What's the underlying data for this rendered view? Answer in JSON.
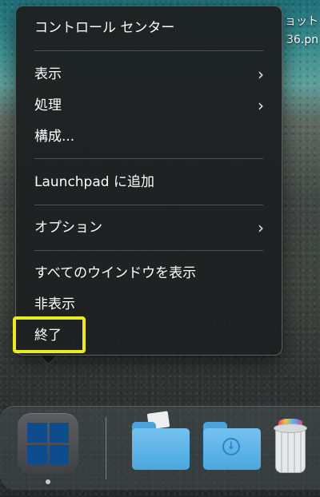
{
  "desktop": {
    "label_line1": "ョット",
    "label_line2": "36.pn"
  },
  "context_menu": {
    "items": [
      {
        "label": "コントロール センター",
        "has_submenu": false
      },
      {
        "label": "表示",
        "has_submenu": true
      },
      {
        "label": "処理",
        "has_submenu": true
      },
      {
        "label": "構成...",
        "has_submenu": false
      },
      {
        "label": "Launchpad に追加",
        "has_submenu": false
      },
      {
        "label": "オプション",
        "has_submenu": true
      },
      {
        "label": "すべてのウインドウを表示",
        "has_submenu": false
      },
      {
        "label": "非表示",
        "has_submenu": false
      },
      {
        "label": "終了",
        "has_submenu": false,
        "highlighted": true
      }
    ],
    "submenu_glyph": "›"
  },
  "dock": {
    "download_glyph": "↓"
  },
  "colors": {
    "highlight": "#e8ec20",
    "menu_background": "#1f2122",
    "folder_blue": "#4aa8e0"
  }
}
